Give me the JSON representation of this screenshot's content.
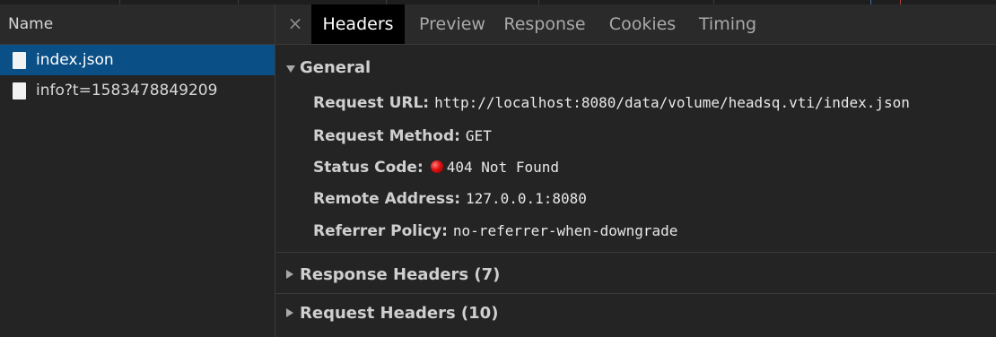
{
  "left_panel": {
    "column_header": "Name",
    "requests": [
      {
        "name": "index.json",
        "selected": true,
        "icon": "document-icon"
      },
      {
        "name": "info?t=1583478849209",
        "selected": false,
        "icon": "document-icon"
      }
    ]
  },
  "tabs": {
    "close_icon": "×",
    "items": [
      "Headers",
      "Preview",
      "Response",
      "Cookies",
      "Timing"
    ],
    "active": "Headers"
  },
  "general": {
    "title": "General",
    "rows": [
      {
        "label": "Request URL:",
        "value": "http://localhost:8080/data/volume/headsq.vti/index.json"
      },
      {
        "label": "Request Method:",
        "value": "GET"
      },
      {
        "label": "Status Code:",
        "value": "404 Not Found",
        "status_color": "#e01010"
      },
      {
        "label": "Remote Address:",
        "value": "127.0.0.1:8080"
      },
      {
        "label": "Referrer Policy:",
        "value": "no-referrer-when-downgrade"
      }
    ]
  },
  "collapsed_sections": {
    "response_headers": "Response Headers (7)",
    "request_headers": "Request Headers (10)"
  },
  "colors": {
    "background": "#242424",
    "selected_row": "#0a4f86",
    "active_tab": "#000000",
    "status_error": "#e01010"
  }
}
